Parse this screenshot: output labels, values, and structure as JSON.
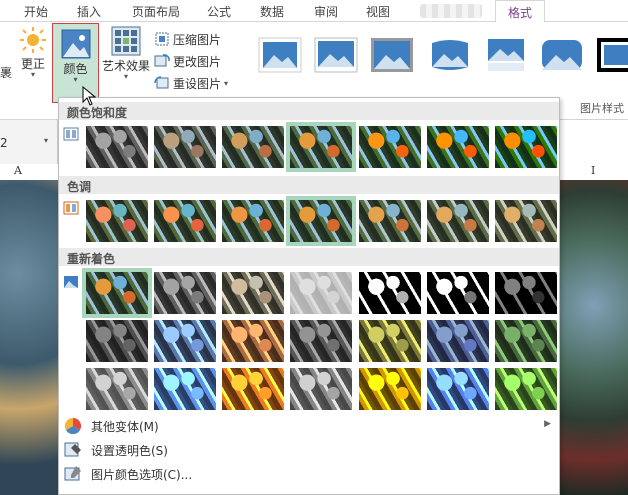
{
  "tabs": {
    "start": "开始",
    "insert": "插入",
    "page_layout": "页面布局",
    "formula": "公式",
    "data": "数据",
    "review": "审阅",
    "view": "视图",
    "format": "格式"
  },
  "ribbon": {
    "partial_left": "裹",
    "correct": "更正",
    "color": "颜色",
    "artistic": "艺术效果",
    "compress": "压缩图片",
    "change": "更改图片",
    "reset": "重设图片",
    "styles_group_label": "图片样式"
  },
  "name_box": {
    "value": "2"
  },
  "columns": {
    "a": "A",
    "i": "I"
  },
  "panel": {
    "saturation_header": "颜色饱和度",
    "tone_header": "色调",
    "recolor_header": "重新着色",
    "more_variants": "其他变体(M)",
    "set_transparent": "设置透明色(S)",
    "color_options": "图片颜色选项(C)..."
  },
  "colors": {
    "accent_tab": "#7b3e8c",
    "selected_highlight": "#a8d6bd",
    "color_button_border": "#d24242"
  }
}
